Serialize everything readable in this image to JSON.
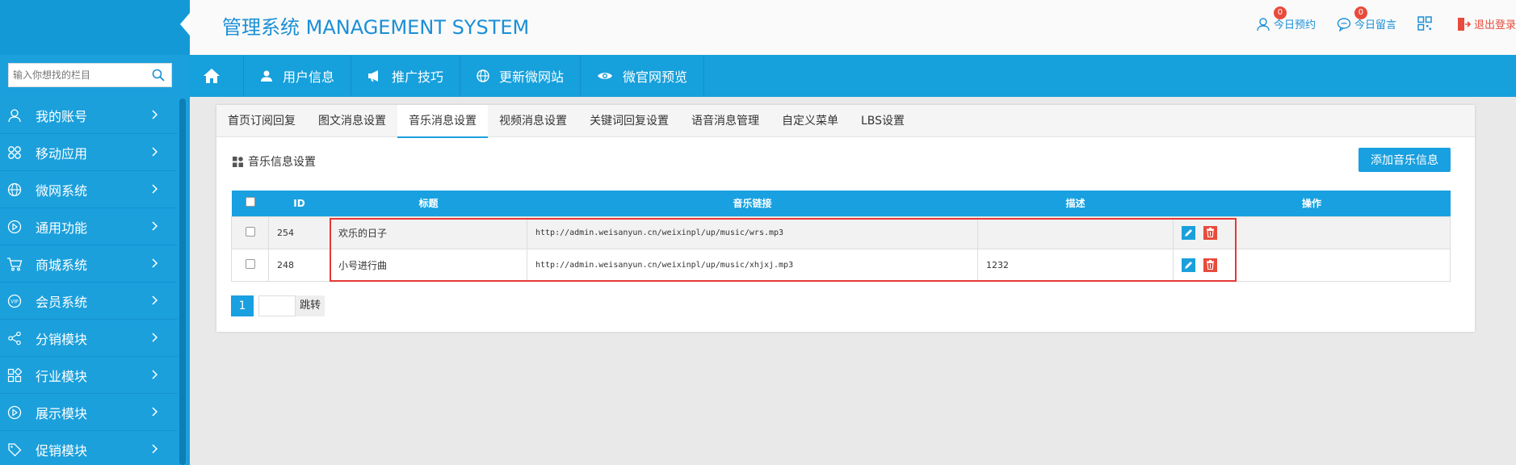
{
  "header": {
    "title": "管理系统 MANAGEMENT SYSTEM",
    "links": [
      {
        "label": "今日预约",
        "badge": "0"
      },
      {
        "label": "今日留言",
        "badge": "0"
      }
    ],
    "logout": "退出登录"
  },
  "sidebar": {
    "search_placeholder": "输入你想找的栏目",
    "items": [
      {
        "label": "我的账号",
        "icon": "user-icon"
      },
      {
        "label": "移动应用",
        "icon": "apps-icon"
      },
      {
        "label": "微网系统",
        "icon": "globe-icon"
      },
      {
        "label": "通用功能",
        "icon": "play-icon"
      },
      {
        "label": "商城系统",
        "icon": "cart-icon"
      },
      {
        "label": "会员系统",
        "icon": "vip-icon"
      },
      {
        "label": "分销模块",
        "icon": "share-icon"
      },
      {
        "label": "行业模块",
        "icon": "grid-icon"
      },
      {
        "label": "展示模块",
        "icon": "play-icon"
      },
      {
        "label": "促销模块",
        "icon": "tag-icon"
      }
    ]
  },
  "navbar": {
    "items": [
      "用户信息",
      "推广技巧",
      "更新微网站",
      "微官网预览"
    ]
  },
  "tabs": [
    "首页订阅回复",
    "图文消息设置",
    "音乐消息设置",
    "视频消息设置",
    "关键词回复设置",
    "语音消息管理",
    "自定义菜单",
    "LBS设置"
  ],
  "active_tab": 2,
  "section": {
    "title": "音乐信息设置",
    "add_button": "添加音乐信息"
  },
  "table": {
    "columns": [
      "ID",
      "标题",
      "音乐链接",
      "描述",
      "操作"
    ],
    "rows": [
      {
        "id": "254",
        "title": "欢乐的日子",
        "url": "http://admin.weisanyun.cn/weixinpl/up/music/wrs.mp3",
        "desc": ""
      },
      {
        "id": "248",
        "title": "小号进行曲",
        "url": "http://admin.weisanyun.cn/weixinpl/up/music/xhjxj.mp3",
        "desc": "1232"
      }
    ]
  },
  "pager": {
    "current": "1",
    "go_label": "跳转"
  },
  "colors": {
    "primary": "#1ba0dc",
    "danger": "#e84b3c",
    "highlight": "#e53935"
  }
}
